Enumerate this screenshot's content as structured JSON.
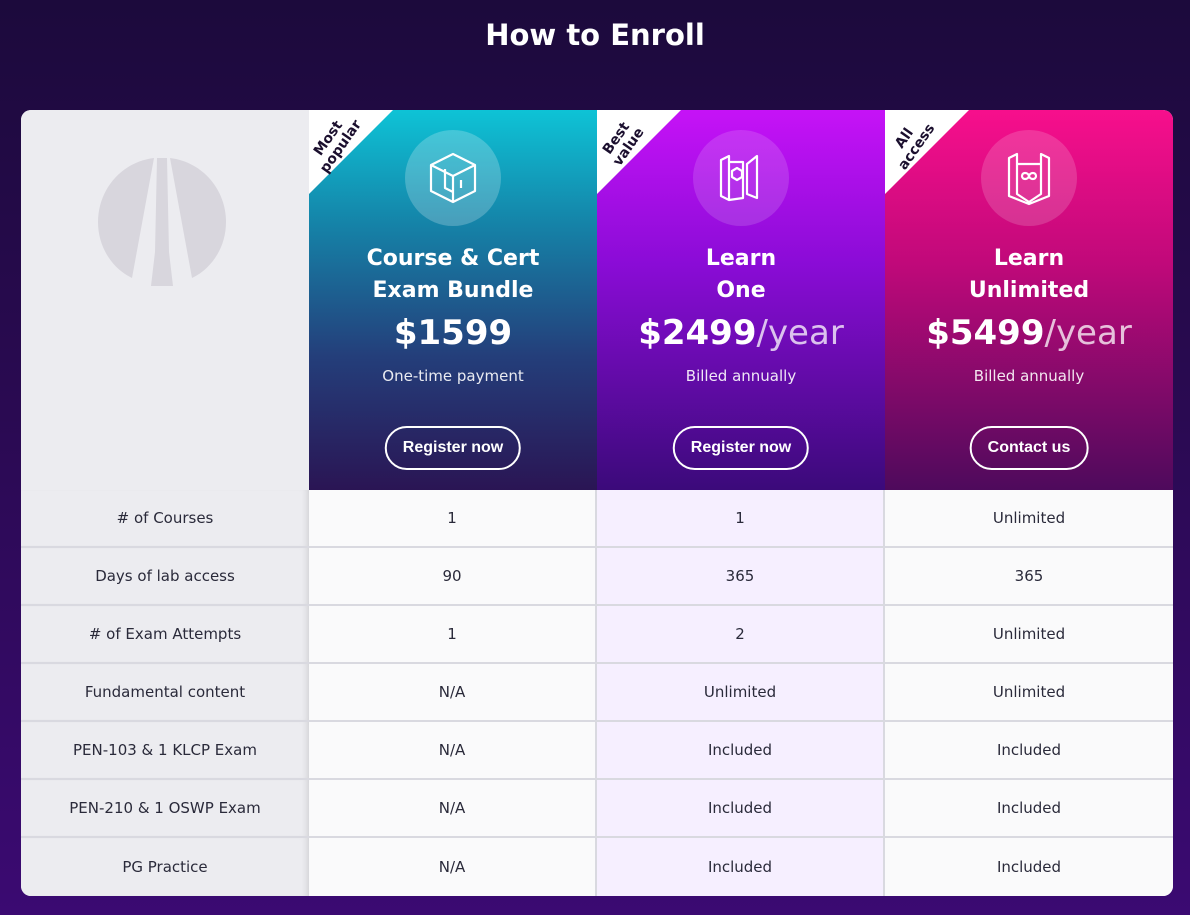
{
  "page_title": "How to Enroll",
  "plans": [
    {
      "ribbon": [
        "Most",
        "popular"
      ],
      "icon": "cube-box-icon",
      "name_lines": [
        "Course & Cert",
        "Exam Bundle"
      ],
      "price": "$1599",
      "per": "",
      "billing": "One-time payment",
      "cta": "Register now",
      "accent": "#0ec3d6"
    },
    {
      "ribbon": [
        "Best",
        "value"
      ],
      "icon": "learn-one-icon",
      "name_lines": [
        "Learn",
        "One"
      ],
      "price": "$2499",
      "per": "/year",
      "billing": "Billed annually",
      "cta": "Register now",
      "accent": "#c612f7"
    },
    {
      "ribbon": [
        "All",
        "access"
      ],
      "icon": "learn-unlimited-icon",
      "name_lines": [
        "Learn",
        "Unlimited"
      ],
      "price": "$5499",
      "per": "/year",
      "billing": "Billed annually",
      "cta": "Contact us",
      "accent": "#f70f8c"
    }
  ],
  "rows": [
    {
      "label": "# of Courses",
      "values": [
        "1",
        "1",
        "Unlimited"
      ]
    },
    {
      "label": "Days of lab access",
      "values": [
        "90",
        "365",
        "365"
      ]
    },
    {
      "label": "# of Exam Attempts",
      "values": [
        "1",
        "2",
        "Unlimited"
      ]
    },
    {
      "label": "Fundamental content",
      "values": [
        "N/A",
        "Unlimited",
        "Unlimited"
      ]
    },
    {
      "label": "PEN-103 & 1 KLCP Exam",
      "values": [
        "N/A",
        "Included",
        "Included"
      ]
    },
    {
      "label": "PEN-210 & 1 OSWP Exam",
      "values": [
        "N/A",
        "Included",
        "Included"
      ]
    },
    {
      "label": "PG Practice",
      "values": [
        "N/A",
        "Included",
        "Included"
      ]
    }
  ]
}
